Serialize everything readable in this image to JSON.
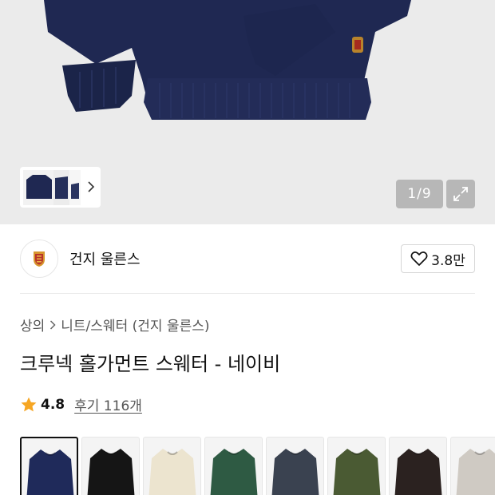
{
  "gallery": {
    "counter": "1/9",
    "expand_icon": "expand-arrows-icon",
    "thumbnail_next_icon": "chevron-right-icon"
  },
  "brand": {
    "name": "건지 울른스",
    "logo_icon": "guernsey-crest-icon",
    "like_count": "3.8만",
    "like_icon": "heart-outline-icon"
  },
  "product": {
    "breadcrumb": [
      "상의",
      "니트/스웨터 (건지 울른스)"
    ],
    "title": "크루넥 홀가먼트 스웨터 - 네이비",
    "rating": "4.8",
    "reviews": "후기 116개",
    "rating_color": "#f6a623"
  },
  "color_options": [
    {
      "color": "#1f2a5a",
      "selected": true
    },
    {
      "color": "#151515",
      "selected": false
    },
    {
      "color": "#ece4cf",
      "selected": false
    },
    {
      "color": "#2e5a43",
      "selected": false
    },
    {
      "color": "#3a4250",
      "selected": false
    },
    {
      "color": "#4a5a33",
      "selected": false
    },
    {
      "color": "#2b2220",
      "selected": false
    },
    {
      "color": "#cfcac3",
      "selected": false
    }
  ]
}
